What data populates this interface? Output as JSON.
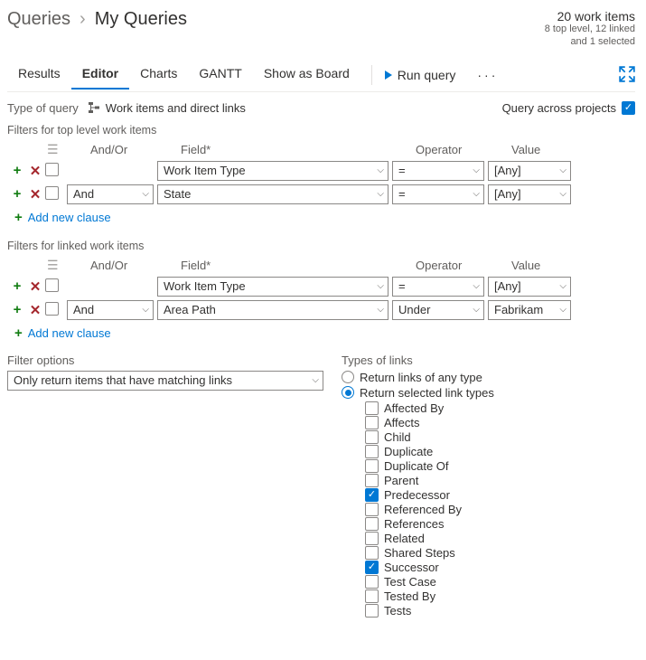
{
  "breadcrumb": {
    "parent": "Queries",
    "current": "My Queries"
  },
  "summary": {
    "main": "20 work items",
    "line1": "8 top level, 12 linked",
    "line2": "and 1 selected"
  },
  "tabs": [
    "Results",
    "Editor",
    "Charts",
    "GANTT",
    "Show as Board"
  ],
  "run_label": "Run query",
  "type_of_query": {
    "label": "Type of query",
    "value": "Work items and direct links"
  },
  "qap_label": "Query across projects",
  "qap_checked": true,
  "headers": {
    "andor": "And/Or",
    "field": "Field*",
    "operator": "Operator",
    "value": "Value"
  },
  "top_filters": {
    "label": "Filters for top level work items",
    "rows": [
      {
        "checked": false,
        "andor": "",
        "field": "Work Item Type",
        "operator": "=",
        "value": "[Any]"
      },
      {
        "checked": false,
        "andor": "And",
        "field": "State",
        "operator": "=",
        "value": "[Any]"
      }
    ]
  },
  "linked_filters": {
    "label": "Filters for linked work items",
    "rows": [
      {
        "checked": false,
        "andor": "",
        "field": "Work Item Type",
        "operator": "=",
        "value": "[Any]"
      },
      {
        "checked": false,
        "andor": "And",
        "field": "Area Path",
        "operator": "Under",
        "value": "Fabrikam"
      }
    ]
  },
  "add_clause_label": "Add new clause",
  "filter_options": {
    "label": "Filter options",
    "value": "Only return items that have matching links"
  },
  "types_of_links": {
    "label": "Types of links",
    "radio_any": "Return links of any type",
    "radio_selected": "Return selected link types",
    "selected_option": "selected",
    "items": [
      {
        "label": "Affected By",
        "checked": false
      },
      {
        "label": "Affects",
        "checked": false
      },
      {
        "label": "Child",
        "checked": false
      },
      {
        "label": "Duplicate",
        "checked": false
      },
      {
        "label": "Duplicate Of",
        "checked": false
      },
      {
        "label": "Parent",
        "checked": false
      },
      {
        "label": "Predecessor",
        "checked": true
      },
      {
        "label": "Referenced By",
        "checked": false
      },
      {
        "label": "References",
        "checked": false
      },
      {
        "label": "Related",
        "checked": false
      },
      {
        "label": "Shared Steps",
        "checked": false
      },
      {
        "label": "Successor",
        "checked": true
      },
      {
        "label": "Test Case",
        "checked": false
      },
      {
        "label": "Tested By",
        "checked": false
      },
      {
        "label": "Tests",
        "checked": false
      }
    ]
  }
}
